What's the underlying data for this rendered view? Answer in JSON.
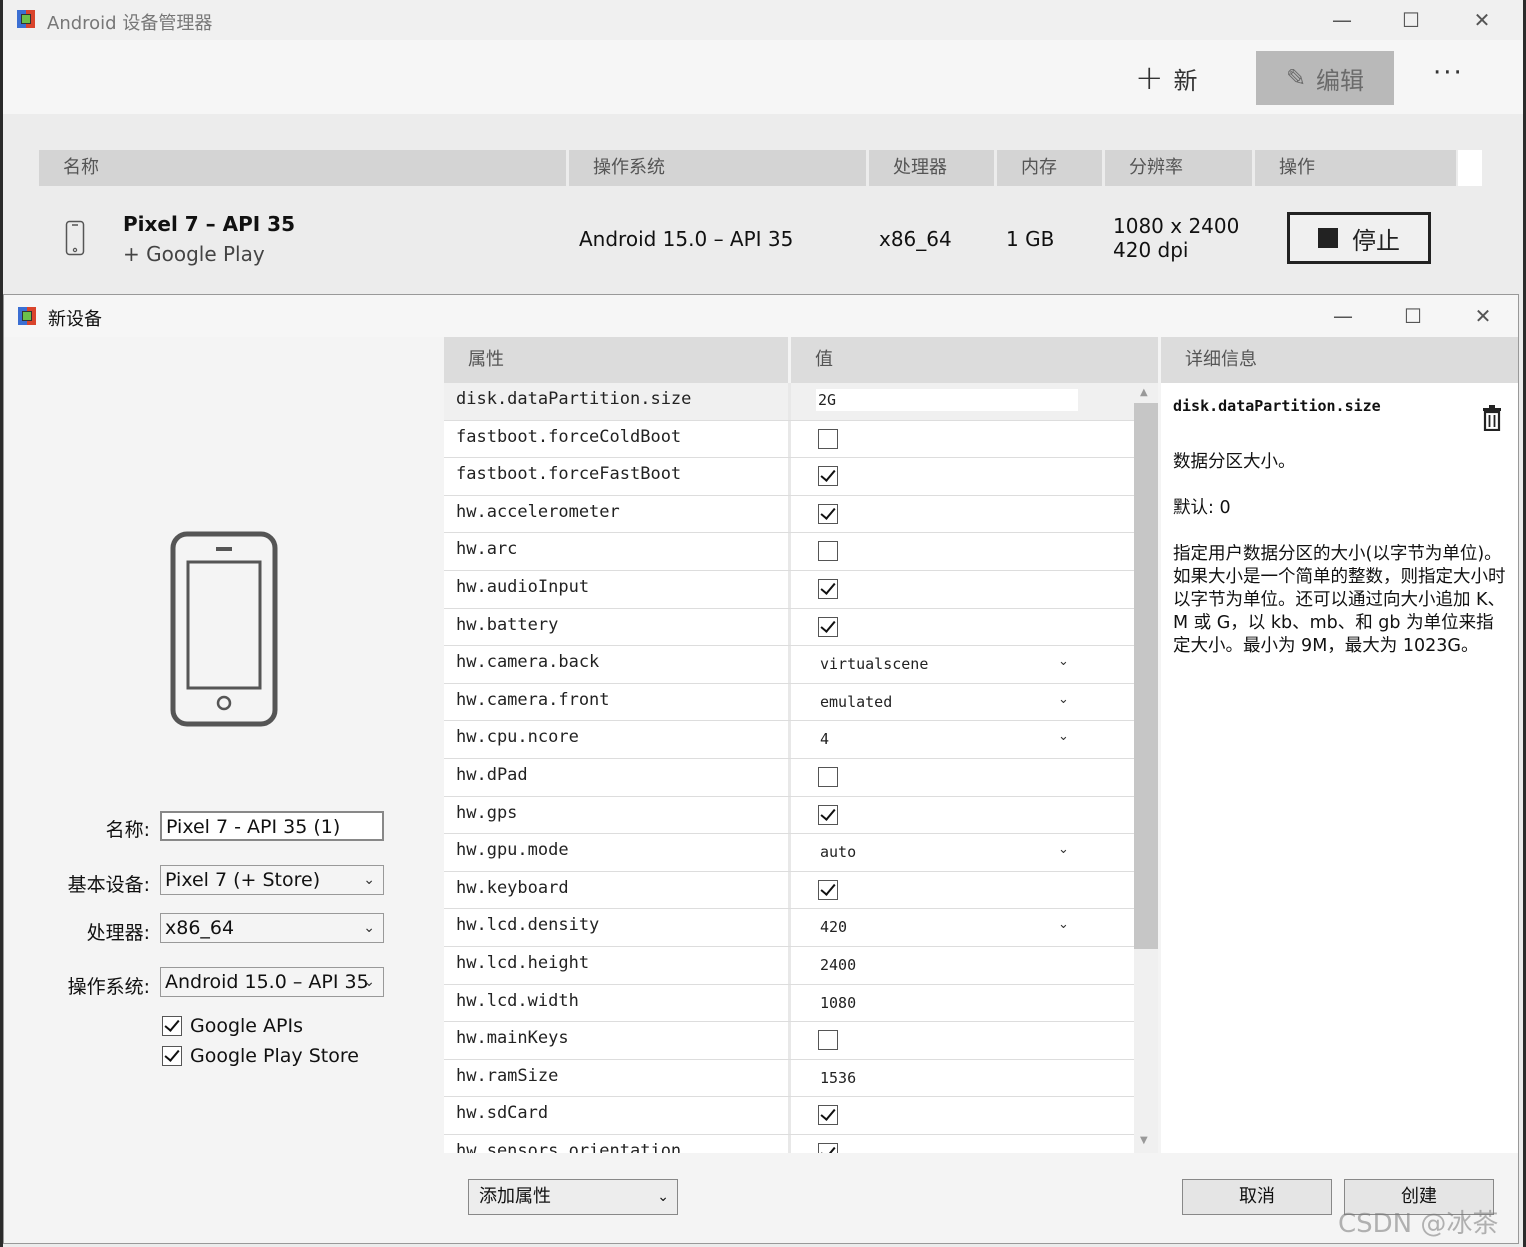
{
  "main_window": {
    "title": "Android 设备管理器",
    "controls": {
      "minimize": "—",
      "maximize": "☐",
      "close": "✕"
    },
    "toolbar": {
      "new_icon": "+",
      "new_label": "新",
      "edit_icon": "✎",
      "edit_label": "编辑",
      "more_label": "···"
    },
    "table": {
      "columns": [
        "名称",
        "操作系统",
        "处理器",
        "内存",
        "分辨率",
        "操作"
      ],
      "rows": [
        {
          "name": "Pixel 7 – API 35",
          "subtitle": "+ Google Play",
          "os": "Android 15.0 – API 35",
          "cpu": "x86_64",
          "memory": "1 GB",
          "resolution": "1080 x 2400",
          "density": "420 dpi",
          "action_label": "停止"
        }
      ]
    }
  },
  "dialog": {
    "title": "新设备",
    "controls": {
      "minimize": "—",
      "maximize": "☐",
      "close": "✕"
    },
    "form": {
      "name_label": "名称:",
      "name_value": "Pixel 7 - API 35 (1)",
      "base_device_label": "基本设备:",
      "base_device_value": "Pixel 7 (+ Store)",
      "processor_label": "处理器:",
      "processor_value": "x86_64",
      "os_label": "操作系统:",
      "os_value": "Android 15.0 – API 35",
      "google_apis_label": "Google APIs",
      "google_apis_checked": true,
      "google_play_label": "Google Play Store",
      "google_play_checked": true
    },
    "properties": {
      "columns": [
        "属性",
        "值"
      ],
      "rows": [
        {
          "name": "disk.dataPartition.size",
          "type": "text",
          "value": "2G",
          "selected": true
        },
        {
          "name": "fastboot.forceColdBoot",
          "type": "check",
          "checked": false
        },
        {
          "name": "fastboot.forceFastBoot",
          "type": "check",
          "checked": true
        },
        {
          "name": "hw.accelerometer",
          "type": "check",
          "checked": true
        },
        {
          "name": "hw.arc",
          "type": "check",
          "checked": false
        },
        {
          "name": "hw.audioInput",
          "type": "check",
          "checked": true
        },
        {
          "name": "hw.battery",
          "type": "check",
          "checked": true
        },
        {
          "name": "hw.camera.back",
          "type": "select",
          "value": "virtualscene"
        },
        {
          "name": "hw.camera.front",
          "type": "select",
          "value": "emulated"
        },
        {
          "name": "hw.cpu.ncore",
          "type": "select",
          "value": "4"
        },
        {
          "name": "hw.dPad",
          "type": "check",
          "checked": false
        },
        {
          "name": "hw.gps",
          "type": "check",
          "checked": true
        },
        {
          "name": "hw.gpu.mode",
          "type": "select",
          "value": "auto"
        },
        {
          "name": "hw.keyboard",
          "type": "check",
          "checked": true
        },
        {
          "name": "hw.lcd.density",
          "type": "select",
          "value": "420"
        },
        {
          "name": "hw.lcd.height",
          "type": "value",
          "value": "2400"
        },
        {
          "name": "hw.lcd.width",
          "type": "value",
          "value": "1080"
        },
        {
          "name": "hw.mainKeys",
          "type": "check",
          "checked": false
        },
        {
          "name": "hw.ramSize",
          "type": "value",
          "value": "1536"
        },
        {
          "name": "hw.sdCard",
          "type": "check",
          "checked": true
        },
        {
          "name": "hw.sensors.orientation",
          "type": "check",
          "checked": true
        }
      ]
    },
    "details": {
      "header": "详细信息",
      "key": "disk.dataPartition.size",
      "summary": "数据分区大小。",
      "default": "默认: 0",
      "description": "指定用户数据分区的大小(以字节为单位)。如果大小是一个简单的整数，则指定大小时以字节为单位。还可以通过向大小追加 K、M 或 G，以 kb、mb、和 gb 为单位来指定大小。最小为 9M，最大为 1023G。"
    },
    "footer": {
      "add_property_label": "添加属性",
      "cancel_label": "取消",
      "create_label": "创建"
    }
  },
  "watermark": "CSDN @冰茶"
}
